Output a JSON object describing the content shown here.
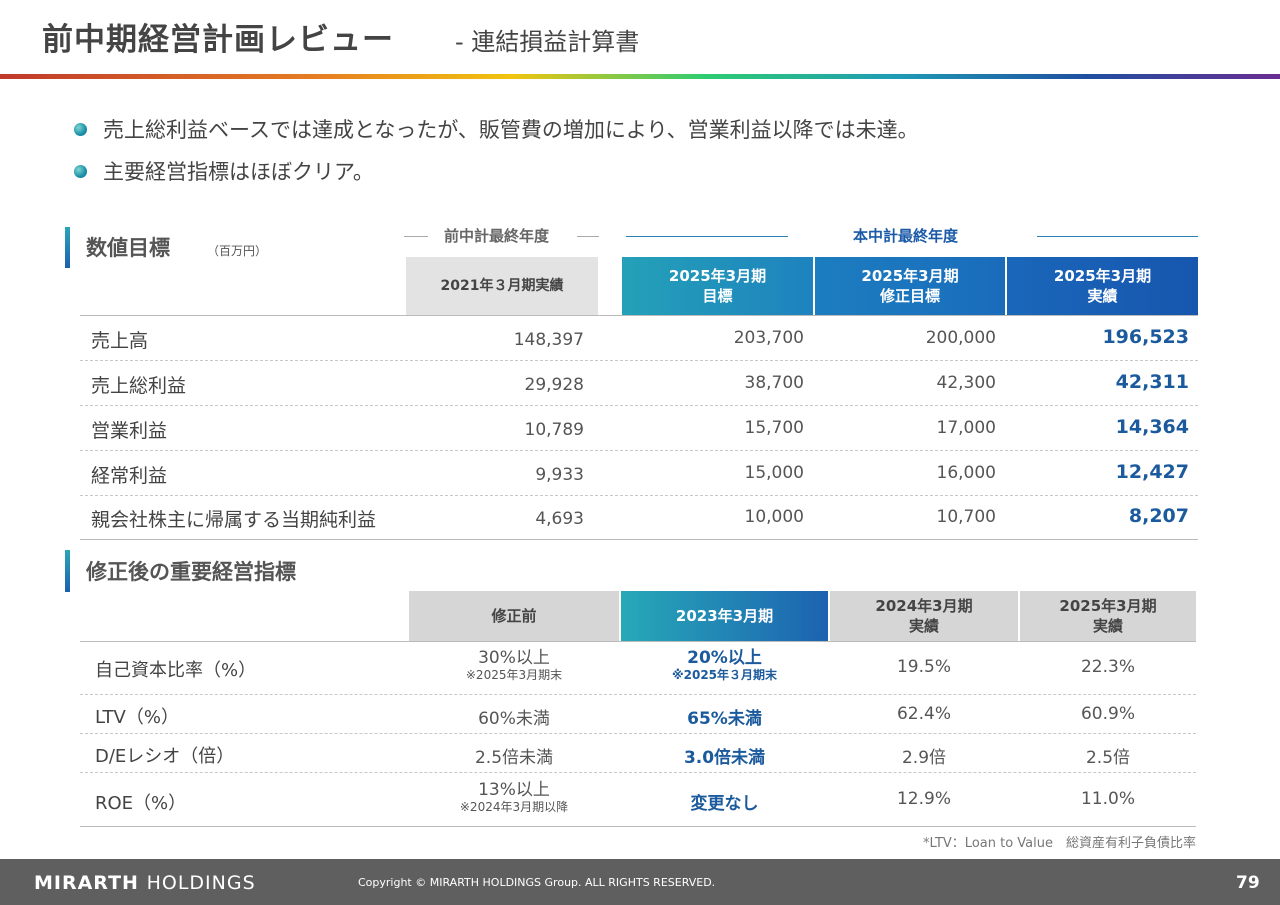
{
  "header": {
    "title": "前中期経営計画レビュー",
    "subtitle": "- 連結損益計算書"
  },
  "bullets": [
    "売上総利益ベースでは達成となったが、販管費の増加により、営業利益以降では未達。",
    "主要経営指標はほぼクリア。"
  ],
  "pl_table": {
    "section_title": "数値目標",
    "unit": "（百万円）",
    "group_prev": "前中計最終年度",
    "group_curr": "本中計最終年度",
    "columns": {
      "prev_actual": "2021年３月期実績",
      "target": [
        "2025年3月期",
        "目標"
      ],
      "revised": [
        "2025年3月期",
        "修正目標"
      ],
      "actual": [
        "2025年3月期",
        "実績"
      ]
    },
    "rows": [
      {
        "label": "売上高",
        "prev": "148,397",
        "target": "203,700",
        "revised": "200,000",
        "actual": "196,523"
      },
      {
        "label": "売上総利益",
        "prev": "29,928",
        "target": "38,700",
        "revised": "42,300",
        "actual": "42,311"
      },
      {
        "label": "営業利益",
        "prev": "10,789",
        "target": "15,700",
        "revised": "17,000",
        "actual": "14,364"
      },
      {
        "label": "経常利益",
        "prev": "9,933",
        "target": "15,000",
        "revised": "16,000",
        "actual": "12,427"
      },
      {
        "label": "親会社株主に帰属する当期純利益",
        "prev": "4,693",
        "target": "10,000",
        "revised": "10,700",
        "actual": "8,207"
      }
    ]
  },
  "kpi_table": {
    "section_title": "修正後の重要経営指標",
    "columns": {
      "before": "修正前",
      "fy2023": "2023年3月期",
      "fy2024": [
        "2024年3月期",
        "実績"
      ],
      "fy2025": [
        "2025年3月期",
        "実績"
      ]
    },
    "rows": [
      {
        "label": "自己資本比率（%）",
        "before": "30%以上",
        "before_note": "※2025年3月期末",
        "fy2023": "20%以上",
        "fy2023_note": "※2025年３月期末",
        "fy2024": "19.5%",
        "fy2025": "22.3%"
      },
      {
        "label": "LTV（%）",
        "before": "60%未満",
        "before_note": "",
        "fy2023": "65%未満",
        "fy2023_note": "",
        "fy2024": "62.4%",
        "fy2025": "60.9%"
      },
      {
        "label": "D/Eレシオ（倍）",
        "before": "2.5倍未満",
        "before_note": "",
        "fy2023": "3.0倍未満",
        "fy2023_note": "",
        "fy2024": "2.9倍",
        "fy2025": "2.5倍"
      },
      {
        "label": "ROE（%）",
        "before": "13%以上",
        "before_note": "※2024年3月期以降",
        "fy2023": "変更なし",
        "fy2023_note": "",
        "fy2024": "12.9%",
        "fy2025": "11.0%"
      }
    ],
    "footnote": "*LTV：Loan to Value　総資産有利子負債比率"
  },
  "footer": {
    "brand_bold": "MIRARTH",
    "brand_light": "HOLDINGS",
    "copyright": "Copyright © MIRARTH HOLDINGS Group. ALL RIGHTS RESERVED.",
    "page_number": "79"
  },
  "colors": {
    "accent_blue": "#1b5a9c",
    "header_teal": "#24a1b8",
    "header_blue": "#1756ae",
    "footer_grey": "#5f5f5f"
  }
}
